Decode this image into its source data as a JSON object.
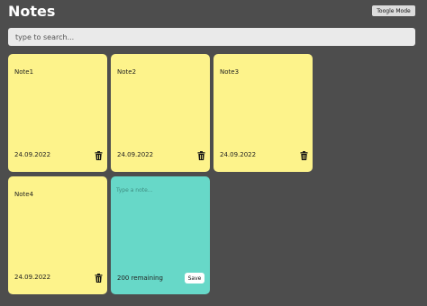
{
  "header": {
    "title": "Notes",
    "toggle_label": "Toogle Mode"
  },
  "search": {
    "placeholder": "type to search..."
  },
  "notes": [
    {
      "text": "Note1",
      "date": "24.09.2022"
    },
    {
      "text": "Note2",
      "date": "24.09.2022"
    },
    {
      "text": "Note3",
      "date": "24.09.2022"
    },
    {
      "text": "Note4",
      "date": "24.09.2022"
    }
  ],
  "new_note": {
    "placeholder": "Type a note...",
    "remaining": "200 remaining",
    "save_label": "Save"
  },
  "colors": {
    "background": "#4d4d4d",
    "note": "#fdf38b",
    "new_note": "#67d8c8"
  },
  "icons": {
    "delete": "trash-icon"
  }
}
